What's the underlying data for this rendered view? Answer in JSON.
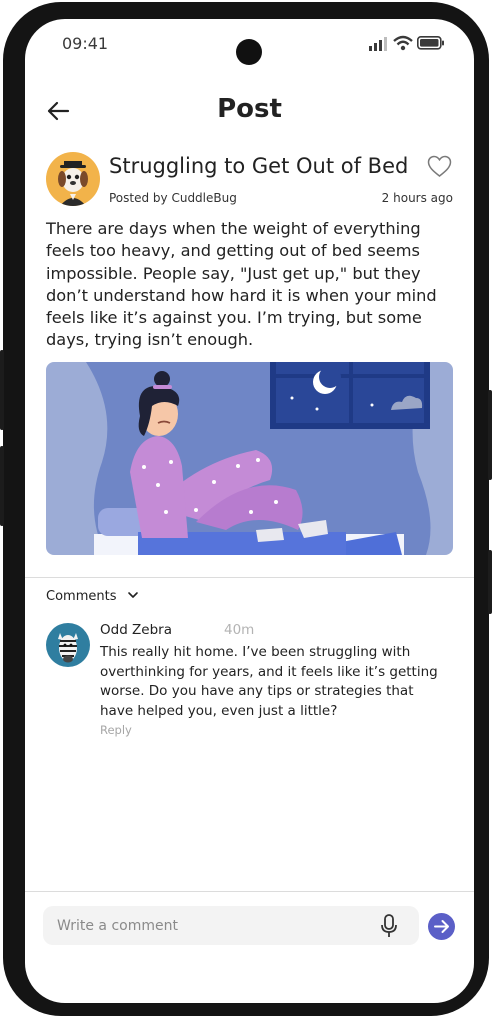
{
  "status_bar": {
    "time": "09:41"
  },
  "header": {
    "title": "Post"
  },
  "post": {
    "title": "Struggling to Get Out of Bed",
    "posted_by": "Posted by CuddleBug",
    "time": "2 hours ago",
    "body": "There are days when the weight of everything feels too heavy, and getting out of bed seems impossible. People say, \"Just get up,\" but they don’t understand how hard it is when your mind feels like it’s against you. I’m trying, but some days, trying isn’t enough."
  },
  "comments": {
    "label": "Comments",
    "items": [
      {
        "author": "Odd Zebra",
        "time": "40m",
        "text": "This really hit home. I’ve been struggling with overthinking for years, and it feels like it’s getting worse. Do you have any tips or strategies that have helped you, even just a little?",
        "reply_label": "Reply"
      }
    ]
  },
  "composer": {
    "placeholder": "Write a comment"
  },
  "icons": [
    "back-arrow-icon",
    "heart-icon",
    "chevron-down-icon",
    "microphone-icon",
    "send-arrow-icon",
    "signal-icon",
    "wifi-icon",
    "battery-icon"
  ],
  "colors": {
    "accent": "#5b5fc7",
    "avatar_bg": "#f2b34a",
    "illustration_bg": "#6f86c6",
    "pajamas": "#c48bd6"
  }
}
